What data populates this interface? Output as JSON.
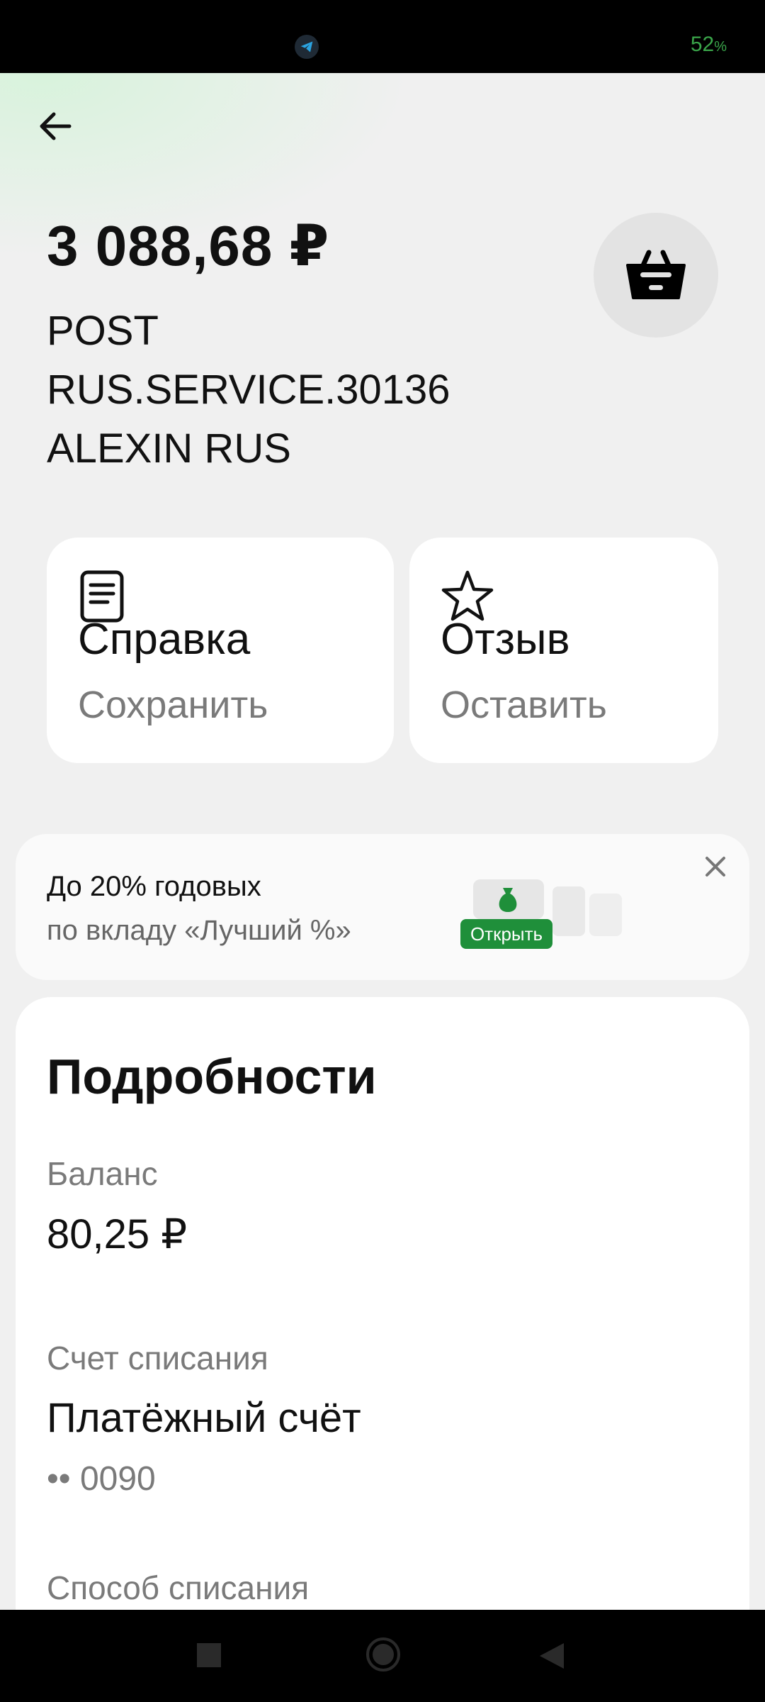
{
  "status_bar": {
    "battery_value": "52",
    "battery_unit": "%"
  },
  "transaction": {
    "amount": "3 088,68 ₽",
    "merchant_line1": "POST",
    "merchant_line2": "RUS.SERVICE.30136",
    "merchant_line3": "ALEXIN RUS"
  },
  "actions": {
    "receipt_title": "Справка",
    "receipt_sub": "Сохранить",
    "review_title": "Отзыв",
    "review_sub": "Оставить"
  },
  "promo": {
    "title": "До 20% годовых",
    "subtitle": "по вкладу «Лучший %»",
    "button": "Открыть",
    "accent": "#1f8f3a"
  },
  "details": {
    "title": "Подробности",
    "balance_label": "Баланс",
    "balance_value": "80,25 ₽",
    "account_label": "Счет списания",
    "account_value": "Платёжный счёт",
    "account_mask": "•• 0090",
    "method_label": "Способ списания"
  }
}
